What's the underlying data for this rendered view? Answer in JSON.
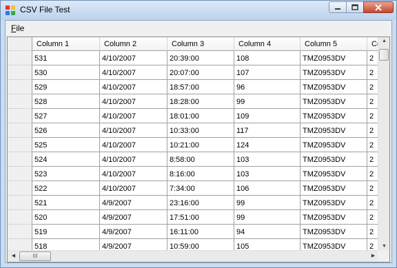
{
  "window": {
    "title": "CSV File Test"
  },
  "menu": {
    "file_label": "File",
    "file_mnemonic": "F",
    "file_rest": "ile"
  },
  "grid": {
    "columns": [
      "Column 1",
      "Column 2",
      "Column 3",
      "Column 4",
      "Column 5",
      "Colu"
    ],
    "rows": [
      [
        "531",
        "4/10/2007",
        "20:39:00",
        "108",
        "TMZ0953DV",
        "2"
      ],
      [
        "530",
        "4/10/2007",
        "20:07:00",
        "107",
        "TMZ0953DV",
        "2"
      ],
      [
        "529",
        "4/10/2007",
        "18:57:00",
        "96",
        "TMZ0953DV",
        "2"
      ],
      [
        "528",
        "4/10/2007",
        "18:28:00",
        "99",
        "TMZ0953DV",
        "2"
      ],
      [
        "527",
        "4/10/2007",
        "18:01:00",
        "109",
        "TMZ0953DV",
        "2"
      ],
      [
        "526",
        "4/10/2007",
        "10:33:00",
        "117",
        "TMZ0953DV",
        "2"
      ],
      [
        "525",
        "4/10/2007",
        "10:21:00",
        "124",
        "TMZ0953DV",
        "2"
      ],
      [
        "524",
        "4/10/2007",
        "8:58:00",
        "103",
        "TMZ0953DV",
        "2"
      ],
      [
        "523",
        "4/10/2007",
        "8:16:00",
        "103",
        "TMZ0953DV",
        "2"
      ],
      [
        "522",
        "4/10/2007",
        "7:34:00",
        "106",
        "TMZ0953DV",
        "2"
      ],
      [
        "521",
        "4/9/2007",
        "23:16:00",
        "99",
        "TMZ0953DV",
        "2"
      ],
      [
        "520",
        "4/9/2007",
        "17:51:00",
        "99",
        "TMZ0953DV",
        "2"
      ],
      [
        "519",
        "4/9/2007",
        "16:11:00",
        "94",
        "TMZ0953DV",
        "2"
      ],
      [
        "518",
        "4/9/2007",
        "10:59:00",
        "105",
        "TMZ0953DV",
        "2"
      ]
    ]
  },
  "scroll": {
    "hthumb_grip": "III"
  },
  "icons": {
    "app": "app-grid-icon",
    "minimize": "minimize-icon",
    "maximize": "maximize-icon",
    "close": "close-icon"
  }
}
